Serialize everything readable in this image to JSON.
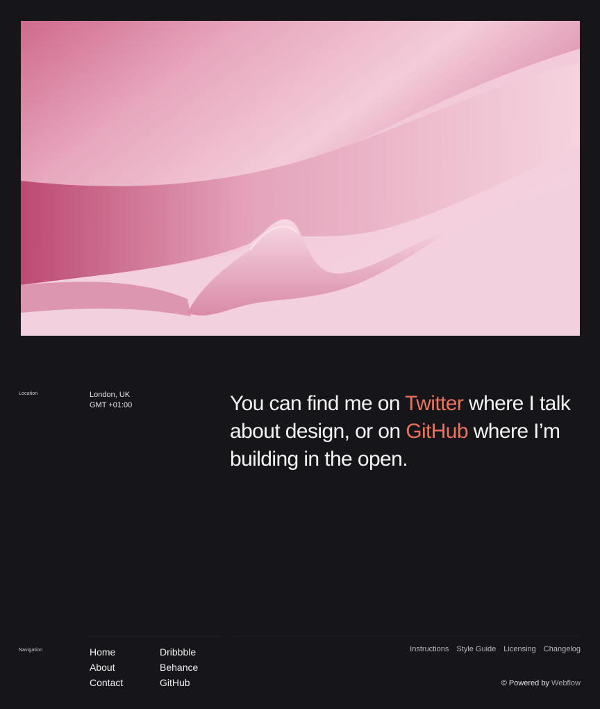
{
  "hero": {
    "image_description": "abstract pink satin fabric",
    "colors": {
      "light": "#f6d6e2",
      "mid": "#e7a7bd",
      "deep": "#c4567b"
    }
  },
  "location": {
    "label": "Location",
    "city": "London, UK",
    "timezone": "GMT +01:00"
  },
  "statement": {
    "part1": "You can find me on ",
    "twitter": "Twitter",
    "part2": " where I talk about design, or on ",
    "github": "GitHub",
    "part3": " where I’m building in the open."
  },
  "navigation": {
    "label": "Navigation",
    "col1": [
      "Home",
      "About",
      "Contact"
    ],
    "col2": [
      "Dribbble",
      "Behance",
      "GitHub"
    ]
  },
  "footer": {
    "links": [
      "Instructions",
      "Style Guide",
      "Licensing",
      "Changelog"
    ],
    "powered_prefix": "© Powered by ",
    "powered_brand": "Webflow"
  },
  "colors": {
    "background": "#161519",
    "accent": "#e9735e"
  }
}
